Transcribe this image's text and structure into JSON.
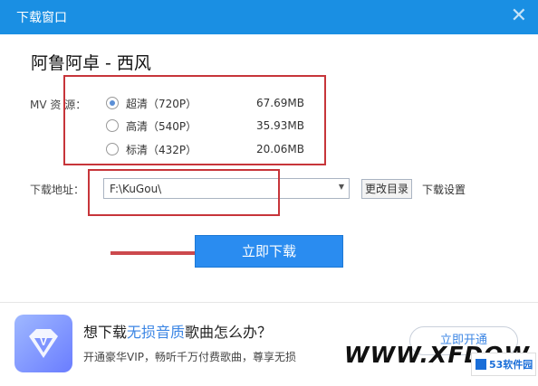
{
  "window": {
    "title": "下载窗口",
    "close_glyph": "✕"
  },
  "song": {
    "title": "阿鲁阿卓 - 西风"
  },
  "mv": {
    "label": "MV 资 源：",
    "options": [
      {
        "label": "超清（720P）",
        "size": "67.69MB",
        "selected": true
      },
      {
        "label": "高清（540P）",
        "size": "35.93MB",
        "selected": false
      },
      {
        "label": "标清（432P）",
        "size": "20.06MB",
        "selected": false
      }
    ]
  },
  "download": {
    "label": "下载地址：",
    "path": "F:\\KuGou\\",
    "change_dir": "更改目录",
    "settings": "下载设置",
    "button": "立即下载"
  },
  "promo": {
    "title_pre": "想下载",
    "title_hl": "无损音质",
    "title_post": "歌曲怎么办？",
    "subtitle": "开通豪华VIP，畅听千万付费歌曲，尊享无损",
    "button": "立即开通"
  },
  "watermark": {
    "text": "WWW.XFDOW",
    "logo": "53软件园"
  },
  "colors": {
    "titlebar": "#1a8fe3",
    "primary": "#2a8cf0",
    "annotation": "#c7353a"
  },
  "icons": {
    "vip": "diamond-icon"
  }
}
